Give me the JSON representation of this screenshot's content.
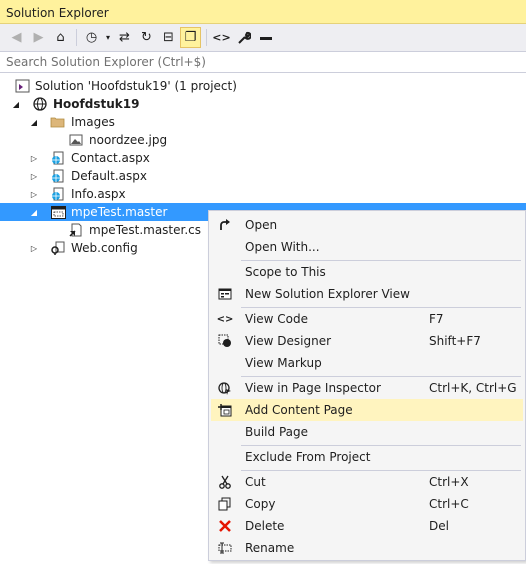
{
  "window": {
    "title": "Solution Explorer"
  },
  "toolbar": {
    "buttons": [
      {
        "name": "back-icon",
        "glyph": "◀"
      },
      {
        "name": "forward-icon",
        "glyph": "▶"
      },
      {
        "name": "home-icon",
        "glyph": "⌂"
      },
      {
        "name": "pending-changes-icon",
        "glyph": "◷"
      },
      {
        "name": "sync-icon",
        "glyph": "⇄"
      },
      {
        "name": "refresh-icon",
        "glyph": "↻"
      },
      {
        "name": "collapse-all-icon",
        "glyph": "⊟"
      },
      {
        "name": "show-all-files-icon",
        "glyph": "❐"
      },
      {
        "name": "view-code-icon",
        "glyph": "<>"
      },
      {
        "name": "properties-icon",
        "glyph": "🔧"
      },
      {
        "name": "preview-icon",
        "glyph": "▬"
      }
    ]
  },
  "search": {
    "placeholder": "Search Solution Explorer (Ctrl+$)"
  },
  "tree": {
    "solution": "Solution 'Hoofdstuk19' (1 project)",
    "project": "Hoofdstuk19",
    "images_folder": "Images",
    "image_file": "noordzee.jpg",
    "contact": "Contact.aspx",
    "default": "Default.aspx",
    "info": "Info.aspx",
    "master": "mpeTest.master",
    "master_cs": "mpeTest.master.cs",
    "webconfig": "Web.config"
  },
  "context_menu": {
    "items": [
      {
        "label": "Open",
        "shortcut": "",
        "icon": "open-icon"
      },
      {
        "label": "Open With...",
        "shortcut": "",
        "icon": ""
      },
      {
        "label": "Scope to This",
        "shortcut": "",
        "icon": ""
      },
      {
        "label": "New Solution Explorer View",
        "shortcut": "",
        "icon": "new-view-icon"
      },
      {
        "label": "View Code",
        "shortcut": "F7",
        "icon": "view-code-icon"
      },
      {
        "label": "View Designer",
        "shortcut": "Shift+F7",
        "icon": "view-designer-icon"
      },
      {
        "label": "View Markup",
        "shortcut": "",
        "icon": ""
      },
      {
        "label": "View in Page Inspector",
        "shortcut": "Ctrl+K, Ctrl+G",
        "icon": "page-inspector-icon"
      },
      {
        "label": "Add Content Page",
        "shortcut": "",
        "icon": "add-content-page-icon"
      },
      {
        "label": "Build Page",
        "shortcut": "",
        "icon": ""
      },
      {
        "label": "Exclude From Project",
        "shortcut": "",
        "icon": ""
      },
      {
        "label": "Cut",
        "shortcut": "Ctrl+X",
        "icon": "cut-icon"
      },
      {
        "label": "Copy",
        "shortcut": "Ctrl+C",
        "icon": "copy-icon"
      },
      {
        "label": "Delete",
        "shortcut": "Del",
        "icon": "delete-icon"
      },
      {
        "label": "Rename",
        "shortcut": "",
        "icon": "rename-icon"
      }
    ],
    "highlighted": "Add Content Page"
  },
  "colors": {
    "title_bg": "#fff29d",
    "selection": "#3399ff",
    "menu_highlight": "#fff4bf",
    "delete": "#e51400"
  }
}
